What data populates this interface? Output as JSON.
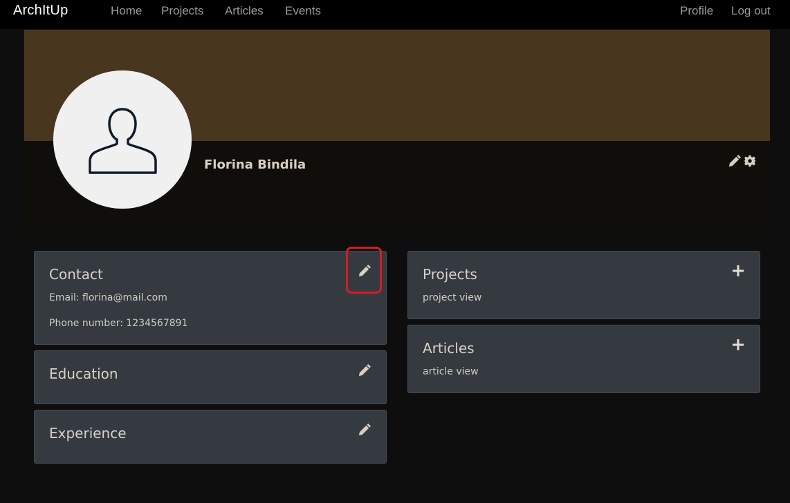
{
  "navbar": {
    "brand": "ArchItUp",
    "links": [
      "Home",
      "Projects",
      "Articles",
      "Events"
    ],
    "right_links": [
      "Profile",
      "Log out"
    ]
  },
  "profile": {
    "name": "Florina Bindila",
    "avatar_icon": "user-outline-icon",
    "cover_color": "#49361f"
  },
  "cards": {
    "contact": {
      "title": "Contact",
      "email": "Email: florina@mail.com",
      "phone": "Phone number: 1234567891",
      "action_icon": "pencil-icon"
    },
    "education": {
      "title": "Education",
      "action_icon": "pencil-icon"
    },
    "experience": {
      "title": "Experience",
      "action_icon": "pencil-icon"
    },
    "projects": {
      "title": "Projects",
      "text": "project view",
      "action_icon": "plus-icon"
    },
    "articles": {
      "title": "Articles",
      "text": "article view",
      "action_icon": "plus-icon"
    }
  },
  "colors": {
    "navbar": "#000000",
    "card_bg": "#343a40",
    "text": "#d6d0c4",
    "highlight": "#d91c22"
  }
}
